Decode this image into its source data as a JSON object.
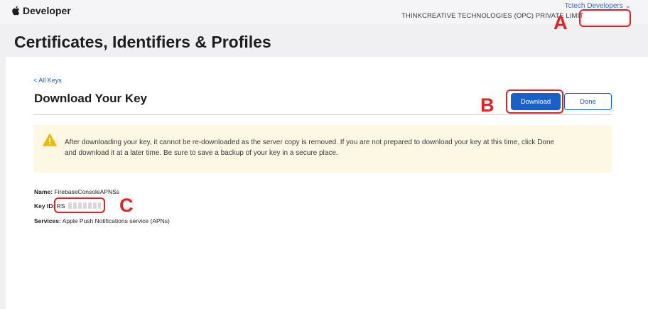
{
  "topbar": {
    "brand": "Developer",
    "team_name": "Tctech Developers",
    "team_org": "THINKCREATIVE TECHNOLOGIES (OPC) PRIVATE LIMITED - 2R"
  },
  "page": {
    "title": "Certificates, Identifiers & Profiles"
  },
  "key_page": {
    "back_link": "< All Keys",
    "heading": "Download Your Key",
    "download_label": "Download",
    "done_label": "Done",
    "warning": "After downloading your key, it cannot be re-downloaded as the server copy is removed. If you are not prepared to download your key at this time, click Done and download it at a later time. Be sure to save a backup of your key in a secure place."
  },
  "details": {
    "name_label": "Name:",
    "name_value": "FirebaseConsoleAPNSs",
    "key_id_label": "Key ID:",
    "key_id_value": "RS",
    "services_label": "Services:",
    "services_value": "Apple Push Notifications service (APNs)"
  },
  "annotations": {
    "a": "A",
    "b": "B",
    "c": "C",
    "color": "#e22222"
  },
  "colors": {
    "accent": "#1a60c9",
    "link": "#0a5fd6",
    "warning_bg": "#fdf8e4",
    "warning_icon": "#f2b705"
  }
}
